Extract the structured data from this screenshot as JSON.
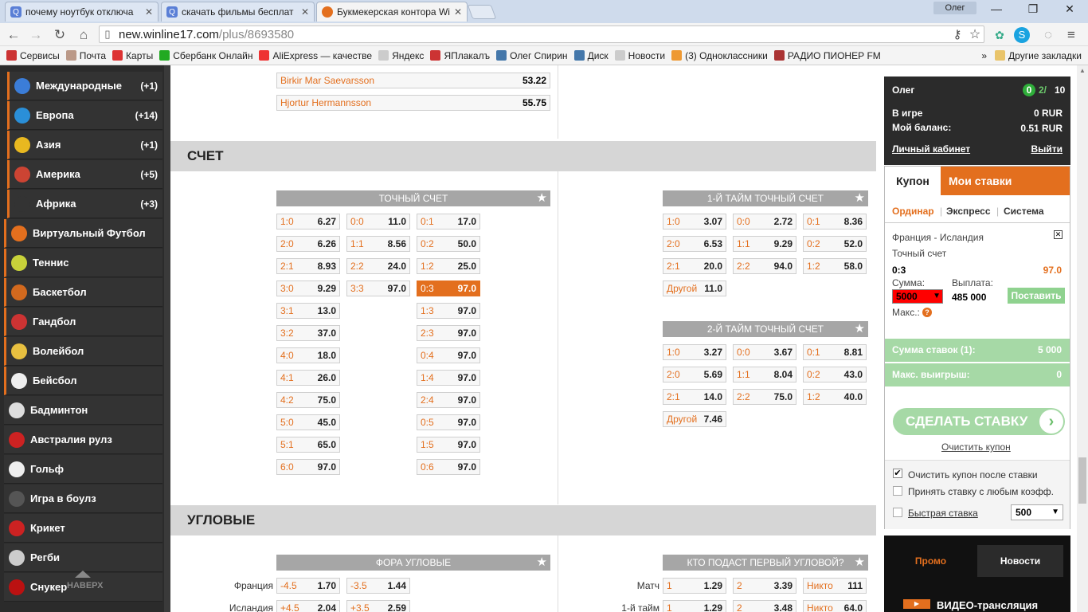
{
  "browser": {
    "tabs": [
      {
        "label": "почему ноутбук отключа",
        "icon": "search-favicon",
        "color": "#5a7fd6"
      },
      {
        "label": "скачать фильмы бесплат",
        "icon": "search-favicon",
        "color": "#5a7fd6"
      },
      {
        "label": "Букмекерская контора Wi",
        "icon": "winline-favicon",
        "color": "#e36f1e"
      }
    ],
    "user": "Олег",
    "url_host": "new.winline17.com",
    "url_path": "/plus/8693580",
    "window_controls": [
      "—",
      "❐",
      "✕"
    ],
    "bookmarks": [
      {
        "label": "Сервисы",
        "color": "#c33"
      },
      {
        "label": "Почта",
        "color": "#b98"
      },
      {
        "label": "Карты",
        "color": "#d33"
      },
      {
        "label": "Сбербанк Онлайн",
        "color": "#2a2"
      },
      {
        "label": "AliExpress — качестве",
        "color": "#e33"
      },
      {
        "label": "Яндекс",
        "color": "#ccc"
      },
      {
        "label": "ЯПлакалъ",
        "color": "#c33"
      },
      {
        "label": "Олег Спирин",
        "color": "#47a"
      },
      {
        "label": "Диск",
        "color": "#47a"
      },
      {
        "label": "Новости",
        "color": "#ccc"
      },
      {
        "label": "(3) Одноклассники",
        "color": "#e93"
      },
      {
        "label": "РАДИО ПИОНЕР FM",
        "color": "#a33"
      }
    ],
    "bookmarks_more": "»",
    "other_bookmarks": "Другие закладки"
  },
  "sidebar": {
    "items": [
      {
        "label": "Международные",
        "count": "(+1)",
        "color": "#3b7dd8"
      },
      {
        "label": "Европа",
        "count": "(+14)",
        "color": "#2a8fd8"
      },
      {
        "label": "Азия",
        "count": "(+1)",
        "color": "#e8b820"
      },
      {
        "label": "Америка",
        "count": "(+5)",
        "color": "#c43"
      },
      {
        "label": "Африка",
        "count": "(+3)",
        "color": "#333"
      },
      {
        "label": "Виртуальный Футбол",
        "count": "",
        "color": "#e36f1e"
      },
      {
        "label": "Теннис",
        "count": "",
        "color": "#c8d23a"
      },
      {
        "label": "Баскетбол",
        "count": "",
        "color": "#d2691e"
      },
      {
        "label": "Гандбол",
        "count": "",
        "color": "#c33"
      },
      {
        "label": "Волейбол",
        "count": "",
        "color": "#e8c040"
      },
      {
        "label": "Бейсбол",
        "count": "",
        "color": "#eee"
      },
      {
        "label": "Бадминтон",
        "count": "",
        "color": "#ddd"
      },
      {
        "label": "Австралия рулз",
        "count": "",
        "color": "#c22"
      },
      {
        "label": "Гольф",
        "count": "",
        "color": "#eee"
      },
      {
        "label": "Игра в боулз",
        "count": "",
        "color": "#555"
      },
      {
        "label": "Крикет",
        "count": "",
        "color": "#c22"
      },
      {
        "label": "Регби",
        "count": "",
        "color": "#ccc"
      },
      {
        "label": "Снукер",
        "count": "",
        "color": "#b11"
      }
    ],
    "up_label": "НАВЕРХ"
  },
  "players": [
    {
      "name": "Birkir Mar Saevarsson",
      "odd": "53.22"
    },
    {
      "name": "Hjortur Hermannsson",
      "odd": "55.75"
    }
  ],
  "score_section": {
    "title": "СЧЕТ",
    "exact": {
      "title": "ТОЧНЫЙ СЧЕТ",
      "col1": [
        [
          "1:0",
          "6.27"
        ],
        [
          "2:0",
          "6.26"
        ],
        [
          "2:1",
          "8.93"
        ],
        [
          "3:0",
          "9.29"
        ],
        [
          "3:1",
          "13.0"
        ],
        [
          "3:2",
          "37.0"
        ],
        [
          "4:0",
          "18.0"
        ],
        [
          "4:1",
          "26.0"
        ],
        [
          "4:2",
          "75.0"
        ],
        [
          "5:0",
          "45.0"
        ],
        [
          "5:1",
          "65.0"
        ],
        [
          "6:0",
          "97.0"
        ]
      ],
      "col2": [
        [
          "0:0",
          "11.0"
        ],
        [
          "1:1",
          "8.56"
        ],
        [
          "2:2",
          "24.0"
        ],
        [
          "3:3",
          "97.0"
        ]
      ],
      "col3": [
        [
          "0:1",
          "17.0"
        ],
        [
          "0:2",
          "50.0"
        ],
        [
          "1:2",
          "25.0"
        ],
        [
          "0:3",
          "97.0"
        ],
        [
          "1:3",
          "97.0"
        ],
        [
          "2:3",
          "97.0"
        ],
        [
          "0:4",
          "97.0"
        ],
        [
          "1:4",
          "97.0"
        ],
        [
          "2:4",
          "97.0"
        ],
        [
          "0:5",
          "97.0"
        ],
        [
          "1:5",
          "97.0"
        ],
        [
          "0:6",
          "97.0"
        ]
      ]
    },
    "half1": {
      "title": "1-Й ТАЙМ ТОЧНЫЙ СЧЕТ",
      "rows": [
        [
          [
            "1:0",
            "3.07"
          ],
          [
            "0:0",
            "2.72"
          ],
          [
            "0:1",
            "8.36"
          ]
        ],
        [
          [
            "2:0",
            "6.53"
          ],
          [
            "1:1",
            "9.29"
          ],
          [
            "0:2",
            "52.0"
          ]
        ],
        [
          [
            "2:1",
            "20.0"
          ],
          [
            "2:2",
            "94.0"
          ],
          [
            "1:2",
            "58.0"
          ]
        ]
      ],
      "other": [
        "Другой",
        "11.0"
      ]
    },
    "half2": {
      "title": "2-Й ТАЙМ ТОЧНЫЙ СЧЕТ",
      "rows": [
        [
          [
            "1:0",
            "3.27"
          ],
          [
            "0:0",
            "3.67"
          ],
          [
            "0:1",
            "8.81"
          ]
        ],
        [
          [
            "2:0",
            "5.69"
          ],
          [
            "1:1",
            "8.04"
          ],
          [
            "0:2",
            "43.0"
          ]
        ],
        [
          [
            "2:1",
            "14.0"
          ],
          [
            "2:2",
            "75.0"
          ],
          [
            "1:2",
            "40.0"
          ]
        ]
      ],
      "other": [
        "Другой",
        "7.46"
      ]
    }
  },
  "corners_section": {
    "title": "УГЛОВЫЕ",
    "handicap": {
      "title": "ФОРА УГЛОВЫЕ",
      "rows": [
        {
          "label": "Франция",
          "cells": [
            [
              "-4.5",
              "1.70"
            ],
            [
              "-3.5",
              "1.44"
            ]
          ]
        },
        {
          "label": "Исландия",
          "cells": [
            [
              "+4.5",
              "2.04"
            ],
            [
              "+3.5",
              "2.59"
            ]
          ]
        }
      ]
    },
    "first": {
      "title": "КТО ПОДАСТ ПЕРВЫЙ УГЛОВОЙ?",
      "rows": [
        {
          "label": "Матч",
          "cells": [
            [
              "1",
              "1.29"
            ],
            [
              "2",
              "3.39"
            ],
            [
              "Никто",
              "111"
            ]
          ]
        },
        {
          "label": "1-й тайм",
          "cells": [
            [
              "1",
              "1.29"
            ],
            [
              "2",
              "3.48"
            ],
            [
              "Никто",
              "64.0"
            ]
          ]
        }
      ]
    }
  },
  "account": {
    "name": "Олег",
    "badge": "0",
    "bets_count": "2/",
    "bets_total": "10",
    "in_game_label": "В игре",
    "in_game_value": "0 RUR",
    "balance_label": "Мой баланс:",
    "balance_value": "0.51 RUR",
    "cabinet_link": "Личный кабинет",
    "logout_link": "Выйти"
  },
  "coupon": {
    "tab_coupon": "Купон",
    "tab_mybets": "Мои ставки",
    "modes": [
      "Ординар",
      "Экспресс",
      "Система"
    ],
    "event": "Франция - Исландия",
    "market": "Точный счет",
    "selection": "0:3",
    "odd": "97.0",
    "sum_label": "Сумма:",
    "sum_value": "5000",
    "payout_label": "Выплата:",
    "payout_value": "485 000",
    "place_label": "Поставить",
    "max_label": "Макс.:",
    "total_label": "Сумма ставок (1):",
    "total_value": "5 000",
    "maxwin_label": "Макс. выигрыш:",
    "maxwin_value": "0",
    "make_bet": "СДЕЛАТЬ СТАВКУ",
    "clear_link": "Очистить купон",
    "opt_clear": "Очистить купон после ставки",
    "opt_any": "Принять ставку с любым коэфф.",
    "opt_fast": "Быстрая ставка",
    "fast_value": "500",
    "colors": {
      "accent": "#e36f1e",
      "green": "#8fd28f",
      "bar": "#a6d9a6"
    }
  },
  "promo": {
    "tab_promo": "Промо",
    "tab_news": "Новости",
    "video": "ВИДЕО-трансляция"
  }
}
